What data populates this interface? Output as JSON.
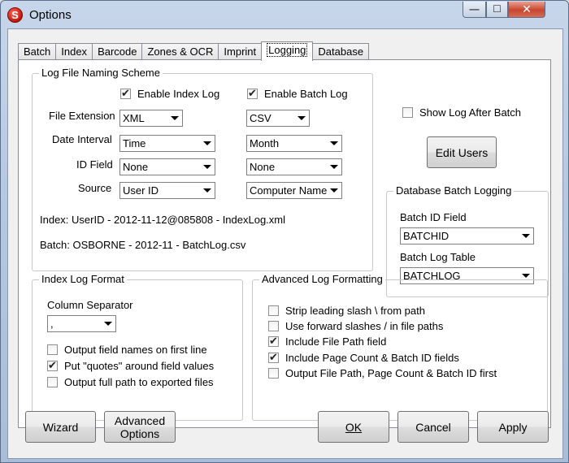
{
  "window": {
    "title": "Options",
    "icon_letter": "S",
    "close_glyph": "✕",
    "min_glyph": "—",
    "max_glyph": "☐"
  },
  "tabs": [
    {
      "label": "Batch"
    },
    {
      "label": "Index"
    },
    {
      "label": "Barcode"
    },
    {
      "label": "Zones & OCR"
    },
    {
      "label": "Imprint"
    },
    {
      "label": "Logging"
    },
    {
      "label": "Database"
    }
  ],
  "active_tab": "Logging",
  "naming": {
    "group_label": "Log File Naming Scheme",
    "enable_index_log": {
      "label": "Enable Index Log",
      "checked": true
    },
    "enable_batch_log": {
      "label": "Enable Batch Log",
      "checked": true
    },
    "file_extension_label": "File Extension",
    "date_interval_label": "Date Interval",
    "id_field_label": "ID Field",
    "source_label": "Source",
    "index_ext": "XML",
    "batch_ext": "CSV",
    "index_interval": "Time",
    "batch_interval": "Month",
    "index_id": "None",
    "batch_id": "None",
    "index_source": "User ID",
    "batch_source": "Computer Name",
    "index_preview": "Index:  UserID - 2012-11-12@085808 - IndexLog.xml",
    "batch_preview": "Batch: OSBORNE - 2012-11 - BatchLog.csv"
  },
  "show_log": {
    "label": "Show Log After Batch",
    "checked": false
  },
  "edit_users_label": "Edit Users",
  "db_logging": {
    "group_label": "Database Batch Logging",
    "batch_id_field_label": "Batch ID Field",
    "batch_id_field_value": "BATCHID",
    "batch_log_table_label": "Batch Log Table",
    "batch_log_table_value": "BATCHLOG"
  },
  "index_format": {
    "group_label": "Index Log Format",
    "column_separator_label": "Column Separator",
    "column_separator_value": ",",
    "options": [
      {
        "label": "Output field names on first line",
        "checked": false
      },
      {
        "label": "Put \"quotes\" around field values",
        "checked": true
      },
      {
        "label": "Output full path to exported files",
        "checked": false
      }
    ]
  },
  "advanced": {
    "group_label": "Advanced Log Formatting",
    "options": [
      {
        "label": "Strip leading slash \\ from path",
        "checked": false
      },
      {
        "label": "Use forward slashes / in file paths",
        "checked": false
      },
      {
        "label": "Include File Path field",
        "checked": true
      },
      {
        "label": "Include Page Count & Batch ID fields",
        "checked": true
      },
      {
        "label": "Output File Path, Page Count & Batch ID first",
        "checked": false
      }
    ]
  },
  "buttons": {
    "wizard": "Wizard",
    "advanced_line1": "Advanced",
    "advanced_line2": "Options",
    "ok": "OK",
    "cancel": "Cancel",
    "apply": "Apply"
  }
}
